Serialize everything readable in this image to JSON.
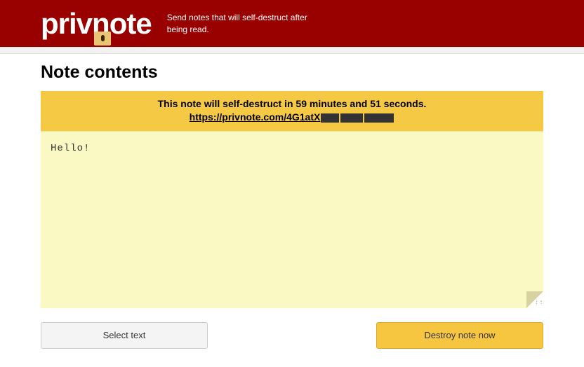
{
  "header": {
    "logo_pre": "priv",
    "logo_o": "n",
    "logo_post": "ote",
    "tagline": "Send notes that will self-destruct after being read."
  },
  "page": {
    "title": "Note contents"
  },
  "notice": {
    "text": "This note will self-destruct in 59 minutes and 51 seconds.",
    "link_visible": "https://privnote.com/4G1atX"
  },
  "note": {
    "content": "Hello!"
  },
  "buttons": {
    "select": "Select text",
    "destroy": "Destroy note now"
  }
}
